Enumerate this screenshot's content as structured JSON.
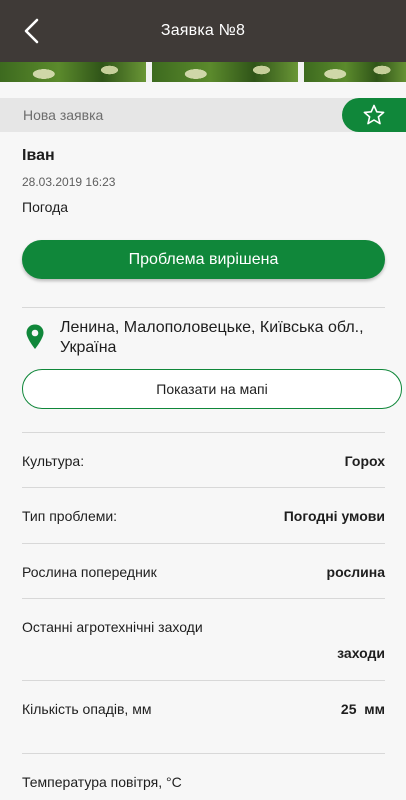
{
  "header": {
    "title": "Заявка №8",
    "back_icon": "chevron-left-icon"
  },
  "photos": [
    "field-photo",
    "field-photo",
    "field-photo"
  ],
  "status": {
    "label": "Нова заявка",
    "favorite_icon": "star-outline-icon"
  },
  "request": {
    "author": "Іван",
    "date": "28.03.2019 16:23",
    "category": "Погода"
  },
  "actions": {
    "resolved_label": "Проблема вирішена",
    "map_label": "Показати на мапі"
  },
  "location": {
    "icon": "map-pin-icon",
    "address": "Ленина, Малополовецьке, Київська обл., Україна"
  },
  "details": [
    {
      "label": "Культура:",
      "value": "Горох"
    },
    {
      "label": "Тип проблеми:",
      "value": "Погодні умови"
    },
    {
      "label": "Рослина попередник",
      "value": "рослина"
    },
    {
      "label": "Останні агротехнічні заходи",
      "value": "заходи"
    },
    {
      "label": "Кількість опадів, мм",
      "value": "25  мм"
    },
    {
      "label": "Температура повітря, °С",
      "value": ""
    }
  ],
  "colors": {
    "accent": "#10873a",
    "header_bg": "#3f3a37",
    "status_bg": "#e6e6e6"
  }
}
